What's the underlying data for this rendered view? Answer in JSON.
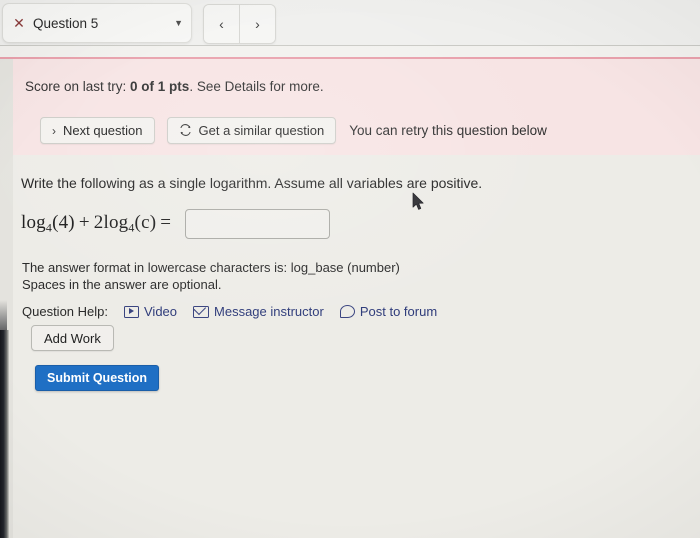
{
  "browser": {
    "tab": {
      "close_icon": "close-icon",
      "title": "Question 5",
      "caret_icon": "chevron-down-icon"
    },
    "nav": {
      "back_icon": "‹",
      "forward_icon": "›"
    }
  },
  "alert": {
    "score_prefix": "Score on last try: ",
    "score_value": "0 of 1 pts",
    "score_suffix": ". See Details for more.",
    "next_question_label": "Next question",
    "next_question_icon": "chevron-right-icon",
    "similar_question_label": "Get a similar question",
    "similar_question_icon": "refresh-icon",
    "retry_note": "You can retry this question below"
  },
  "question": {
    "prompt": "Write the following as a single logarithm. Assume all variables are positive.",
    "equation": {
      "term1_fn": "log",
      "term1_base": "4",
      "term1_arg": "(4)",
      "operator": "+",
      "term2_coef": "2",
      "term2_fn": "log",
      "term2_base": "4",
      "term2_arg": "(c)",
      "equals": "="
    },
    "answer_value": "",
    "answer_placeholder": "",
    "format_note_line1": "The answer format in lowercase characters is: log_base (number)",
    "format_note_line2": "Spaces in the answer are optional."
  },
  "help": {
    "label": "Question Help:",
    "video_label": "Video",
    "video_icon": "video-icon",
    "message_label": "Message instructor",
    "message_icon": "envelope-icon",
    "forum_label": "Post to forum",
    "forum_icon": "speech-bubble-icon"
  },
  "actions": {
    "add_work_label": "Add Work",
    "submit_label": "Submit Question"
  },
  "colors": {
    "alert_background": "#f7e4e4",
    "accent_line": "#e8a0ab",
    "submit_background": "#1f6fc4",
    "link": "#2e3b7a",
    "page_background": "#edece7"
  }
}
